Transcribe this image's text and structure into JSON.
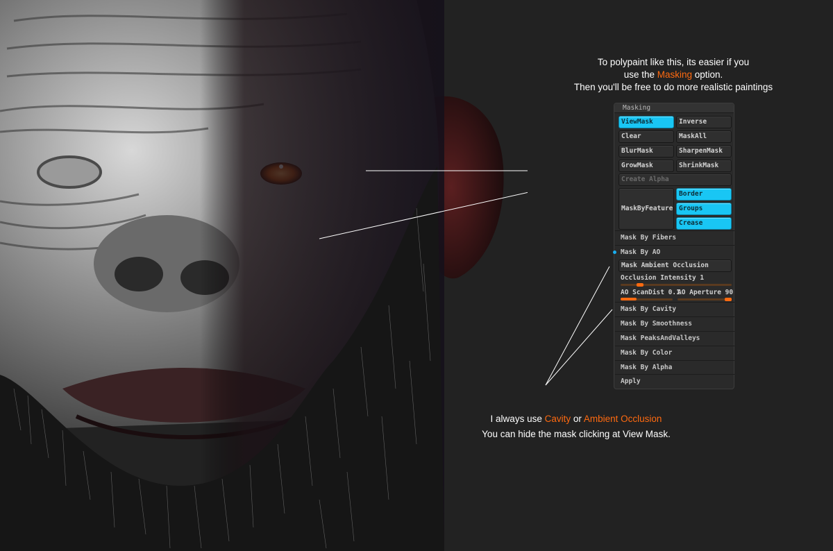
{
  "notes": {
    "top": {
      "line1": "To polypaint like this, its easier if you",
      "line2_prefix": "use the ",
      "line2_highlight": "Masking",
      "line2_suffix": " option.",
      "line3": "Then you'll be free to do more realistic paintings"
    },
    "bottom": {
      "line1_prefix": "I always use ",
      "line1_highlight1": "Cavity",
      "line1_mid": " or ",
      "line1_highlight2": "Ambient Occlusion",
      "line2": "You can hide the mask clicking at View Mask."
    }
  },
  "panel": {
    "title": "Masking",
    "viewmask": "ViewMask",
    "inverse": "Inverse",
    "clear": "Clear",
    "maskall": "MaskAll",
    "blurmask": "BlurMask",
    "sharpenmask": "SharpenMask",
    "growmask": "GrowMask",
    "shrinkmask": "ShrinkMask",
    "create_alpha": "Create Alpha",
    "maskbyfeature": "MaskByFeature",
    "border": "Border",
    "groups": "Groups",
    "crease": "Crease",
    "mask_by_fibers": "Mask By Fibers",
    "mask_by_ao": "Mask By AO",
    "mask_ambient_occlusion": "Mask Ambient Occlusion",
    "occlusion_intensity": "Occlusion Intensity 1",
    "ao_scandist": "AO ScanDist 0.1",
    "ao_aperture": "AO Aperture 90",
    "occlusion_intensity_level": 0.15,
    "ao_scandist_level": 0.3,
    "ao_aperture_level": 1.0,
    "mask_by_cavity": "Mask By Cavity",
    "mask_by_smoothness": "Mask By Smoothness",
    "mask_peaks_valleys": "Mask PeaksAndValleys",
    "mask_by_color": "Mask By Color",
    "mask_by_alpha": "Mask By Alpha",
    "apply": "Apply"
  },
  "colors": {
    "accent": "#ff6a10",
    "active": "#19c6f4",
    "background": "#222222"
  }
}
